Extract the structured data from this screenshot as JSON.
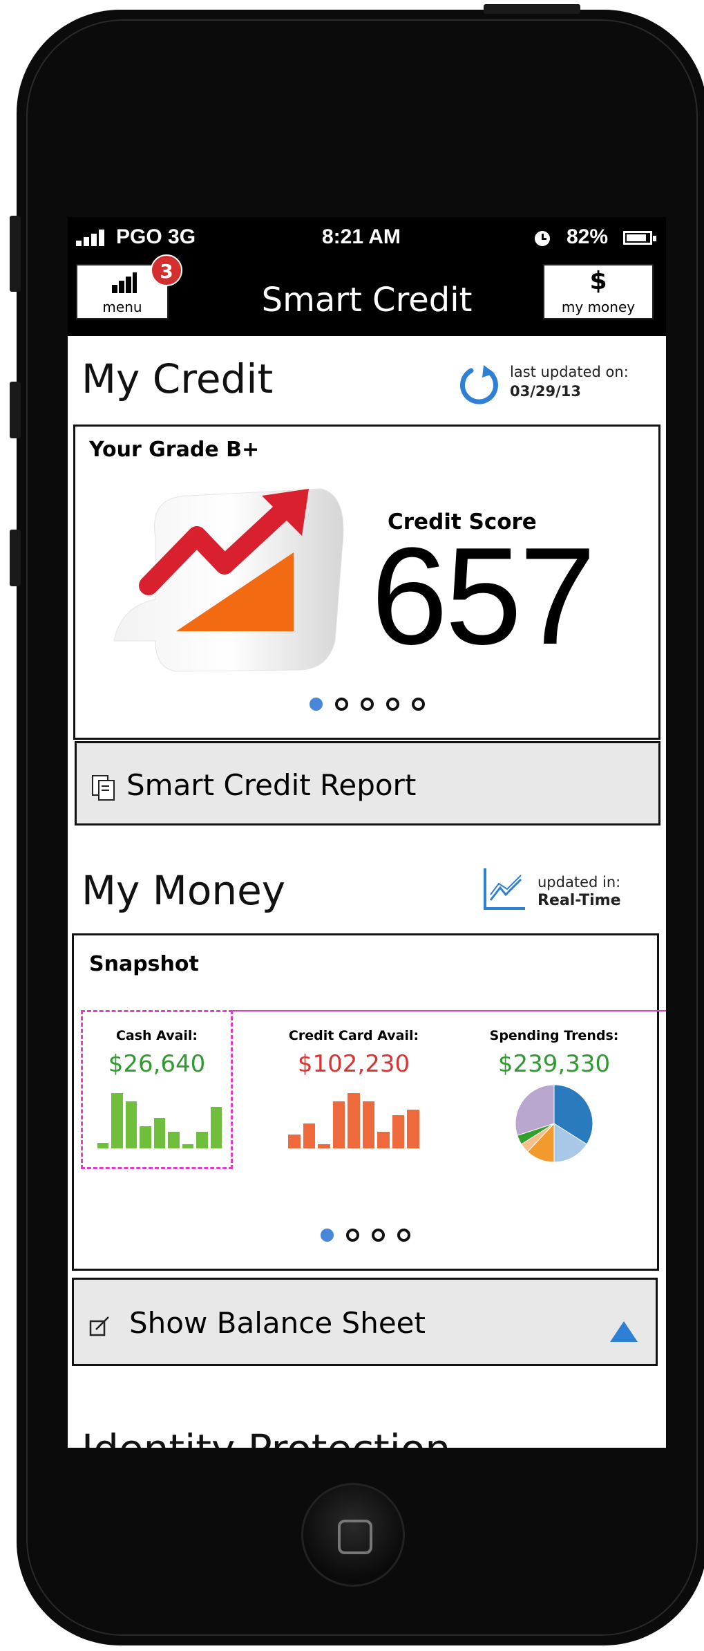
{
  "status": {
    "carrier": "PGO 3G",
    "time": "8:21 AM",
    "battery": "82%"
  },
  "navbar": {
    "title": "Smart Credit",
    "menu_label": "menu",
    "menu_badge": "3",
    "money_symbol": "$",
    "money_label": "my money"
  },
  "my_credit": {
    "title": "My Credit",
    "updated_label": "last updated on:",
    "updated_date": "03/29/13",
    "grade": "Your Grade B+",
    "score_label": "Credit Score",
    "score": "657",
    "pager_count": 5,
    "pager_active": 0,
    "report_button": "Smart Credit Report"
  },
  "my_money": {
    "title": "My Money",
    "updated_label": "updated in:",
    "updated_value": "Real-Time",
    "snapshot_title": "Snapshot",
    "cash": {
      "label": "Cash Avail:",
      "value": "$26,640",
      "color": "#2f9a2f",
      "bars": [
        0.1,
        1.0,
        0.85,
        0.4,
        0.55,
        0.3,
        0.05,
        0.3,
        0.75
      ]
    },
    "credit_card": {
      "label": "Credit Card Avail:",
      "value": "$102,230",
      "color": "#d83434",
      "bars": [
        0.25,
        0.45,
        0.05,
        0.85,
        1.0,
        0.85,
        0.3,
        0.6,
        0.7
      ]
    },
    "spending": {
      "label": "Spending Trends:",
      "value": "$239,330",
      "color": "#2f9a2f",
      "slices": [
        {
          "value": 34,
          "color": "#2a7bbd"
        },
        {
          "value": 16,
          "color": "#a9c8e8"
        },
        {
          "value": 12,
          "color": "#f39a2e"
        },
        {
          "value": 4,
          "color": "#f6c08a"
        },
        {
          "value": 4,
          "color": "#33a02c"
        },
        {
          "value": 30,
          "color": "#b9a7cf"
        }
      ]
    },
    "pager_count": 4,
    "pager_active": 0,
    "balance_button": "Show Balance Sheet"
  },
  "identity": {
    "title": "Identity Protection"
  },
  "colors": {
    "accent": "#4a86d8",
    "badge": "#d32f2f",
    "selection": "#e040c8"
  }
}
